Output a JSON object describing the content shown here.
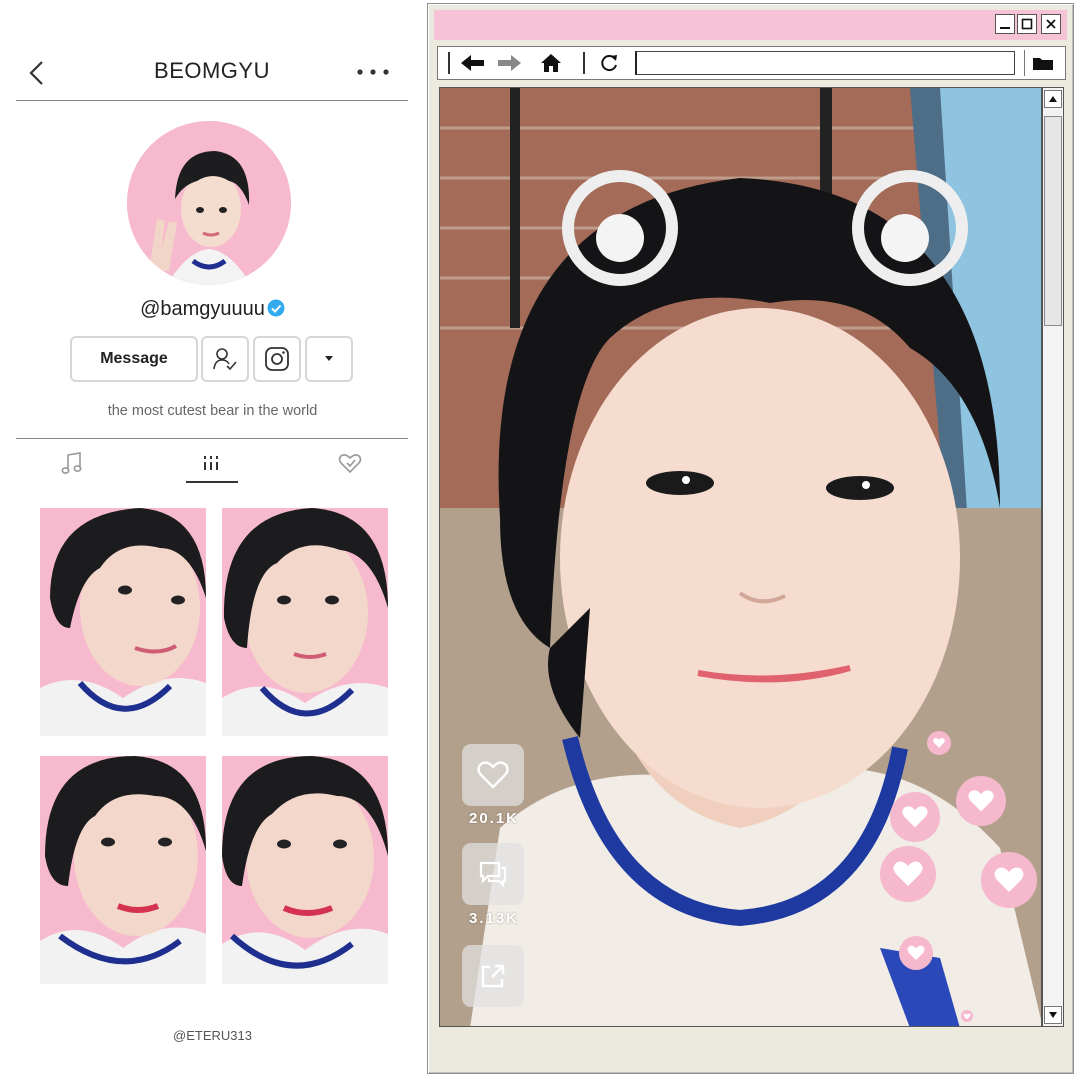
{
  "profile": {
    "title": "BEOMGYU",
    "handle": "@bamgyuuuu",
    "message_label": "Message",
    "bio": "the most cutest bear in the world",
    "tabs": [
      {
        "icon": "music-note-icon"
      },
      {
        "icon": "grid-icon",
        "active": true
      },
      {
        "icon": "liked-heart-icon"
      }
    ]
  },
  "watermark": "@ETERU313",
  "video": {
    "likes": "20.1K",
    "comments": "3.13K"
  },
  "colors": {
    "pink": "#f6c3d6",
    "verified": "#33aaee",
    "heart_bubble": "#f5b8cc"
  }
}
